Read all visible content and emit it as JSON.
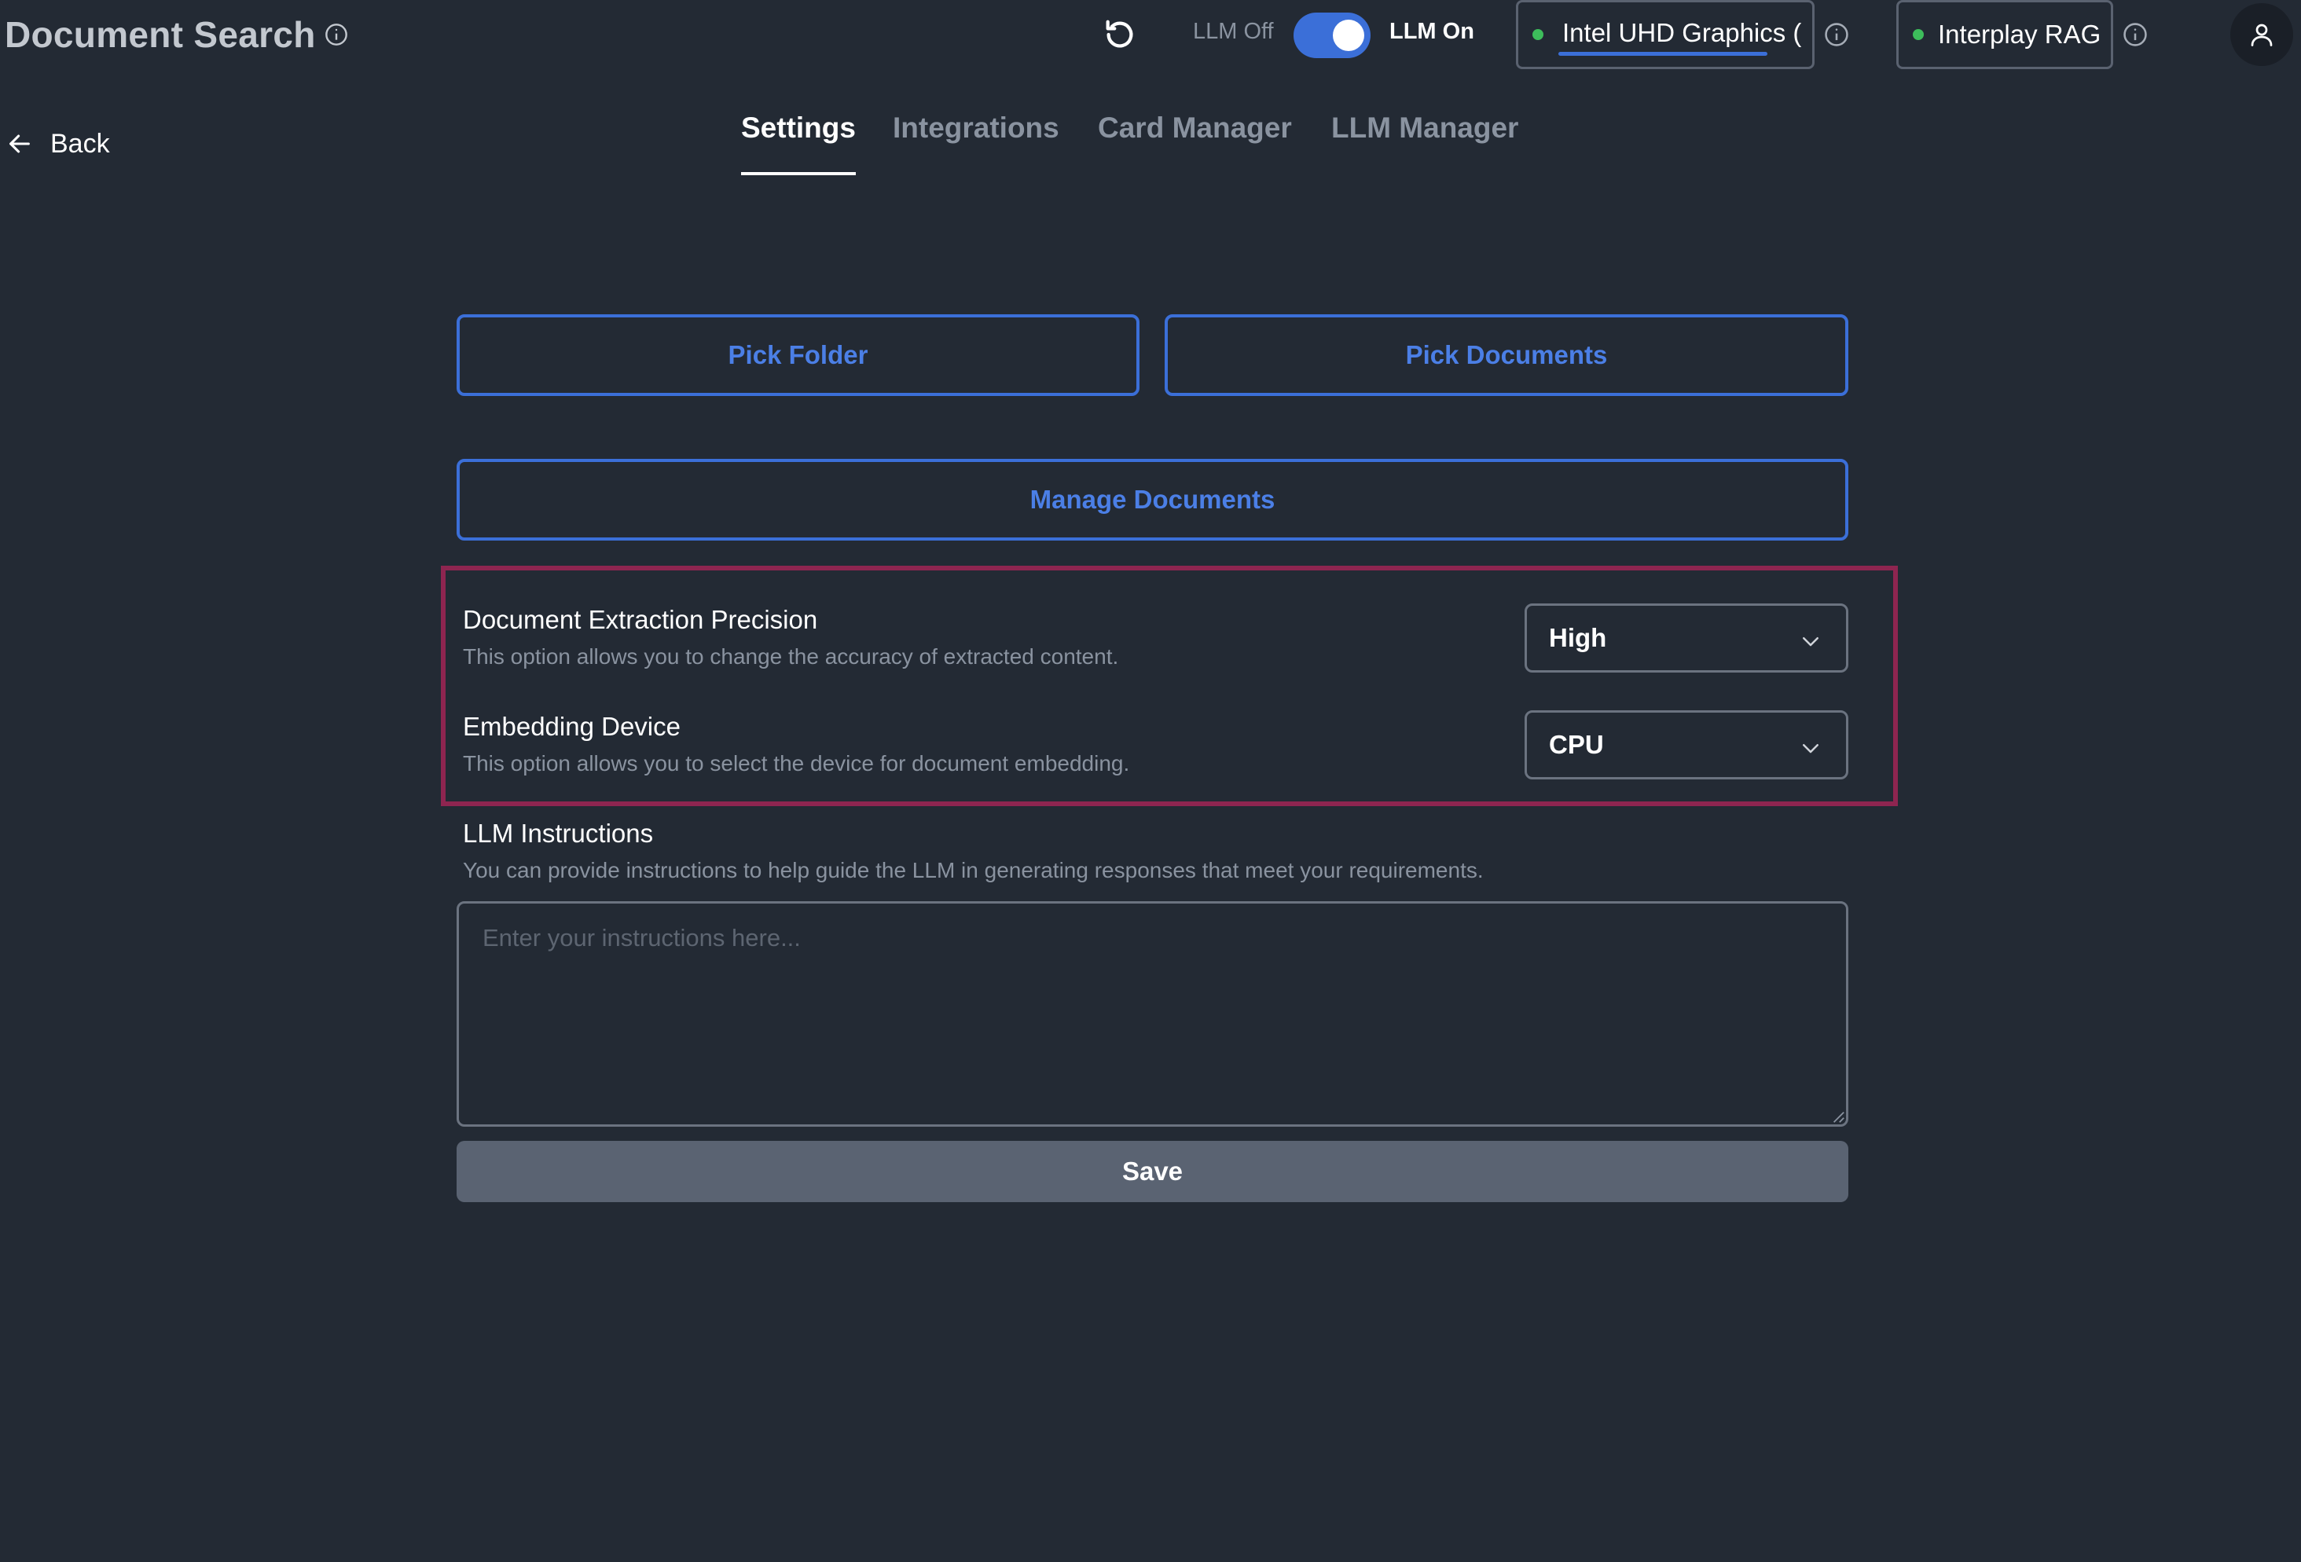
{
  "header": {
    "app_title": "Document Search",
    "llm_off_label": "LLM Off",
    "llm_on_label": "LLM On",
    "llm_enabled": true,
    "device_selector": {
      "label": "Intel UHD Graphics (",
      "status_color": "#3dbd5b"
    },
    "rag_selector": {
      "label": "Interplay RAG",
      "status_color": "#3dbd5b"
    }
  },
  "nav": {
    "back_label": "Back",
    "tabs": [
      {
        "label": "Settings",
        "active": true
      },
      {
        "label": "Integrations",
        "active": false
      },
      {
        "label": "Card Manager",
        "active": false
      },
      {
        "label": "LLM Manager",
        "active": false
      }
    ]
  },
  "actions": {
    "pick_folder": "Pick Folder",
    "pick_documents": "Pick Documents",
    "manage_documents": "Manage Documents"
  },
  "settings": {
    "extraction": {
      "title": "Document Extraction Precision",
      "description": "This option allows you to change the accuracy of extracted content.",
      "value": "High"
    },
    "embedding": {
      "title": "Embedding Device",
      "description": "This option allows you to select the device for document embedding.",
      "value": "CPU"
    },
    "instructions": {
      "title": "LLM Instructions",
      "description": "You can provide instructions to help guide the LLM in generating responses that meet your requirements.",
      "placeholder": "Enter your instructions here...",
      "value": ""
    }
  },
  "save_label": "Save",
  "colors": {
    "background": "#232a34",
    "accent": "#3b6fd8",
    "highlight": "#8e2550",
    "save_button": "#5a6372"
  }
}
